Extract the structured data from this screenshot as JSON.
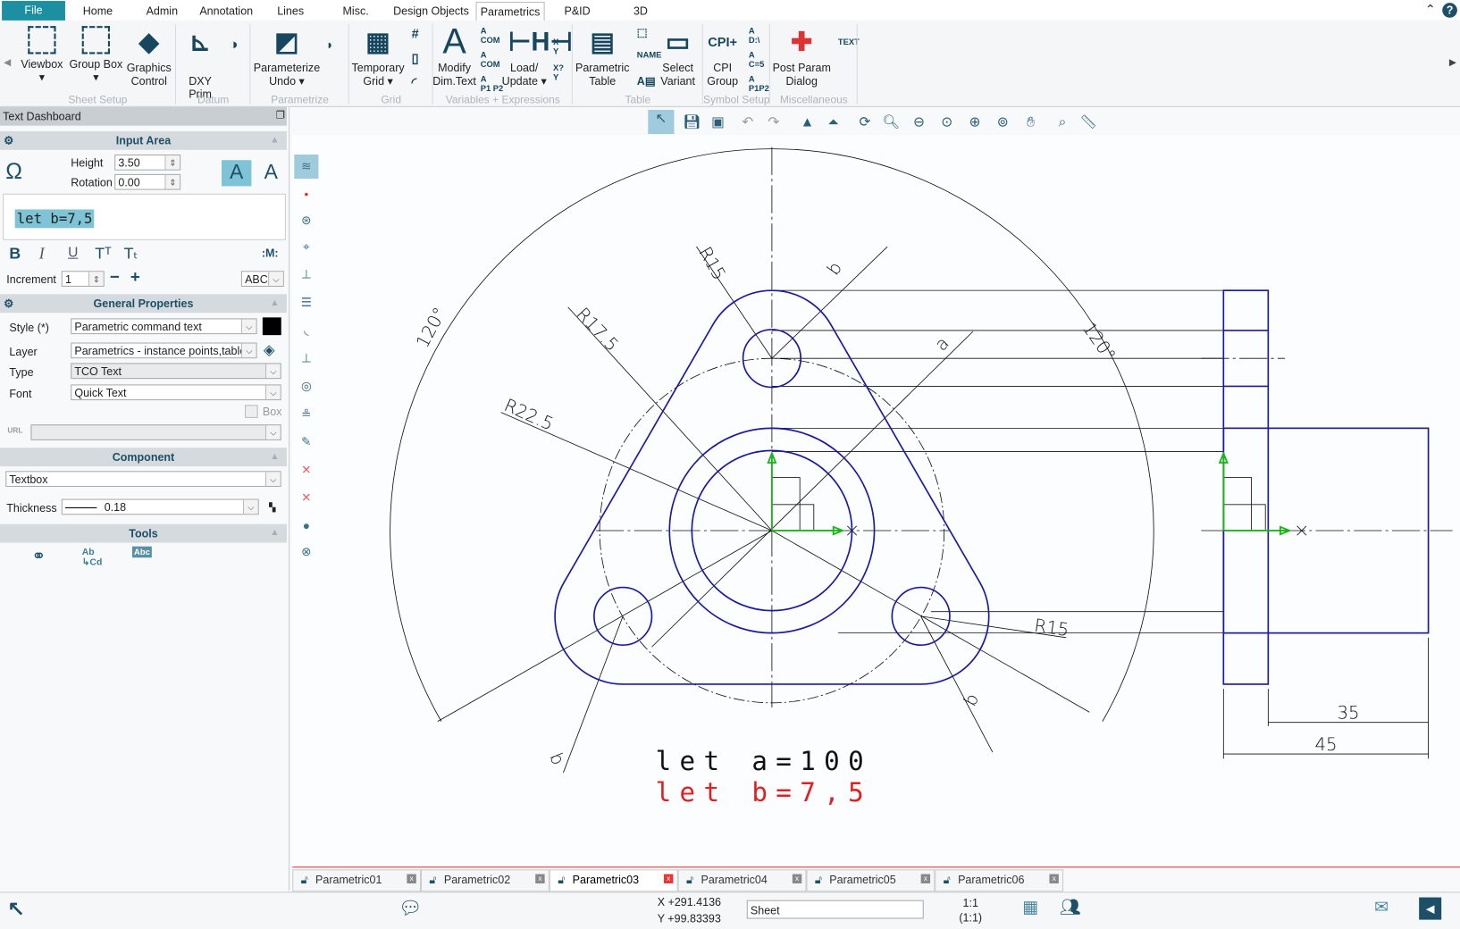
{
  "menu_tabs": [
    "File",
    "Home",
    "Admin",
    "Annotation",
    "Lines",
    "Misc.",
    "Design Objects",
    "Parametrics",
    "P&ID",
    "3D"
  ],
  "active_tab": "Parametrics",
  "ribbon": {
    "buttons": [
      {
        "label": "Viewbox",
        "icon": "viewbox-icon"
      },
      {
        "label": "Group Box",
        "icon": "group-box-icon"
      },
      {
        "label": "Graphics Control",
        "icon": "graphics-control-icon"
      },
      {
        "label": "DXY Prim",
        "icon": "dxy-prim-icon"
      },
      {
        "label": "Parameterize Undo",
        "icon": "parameterize-undo-icon"
      },
      {
        "label": "Temporary Grid",
        "icon": "temporary-grid-icon"
      },
      {
        "label": "Modify Dim.Text",
        "icon": "modify-dim-text-icon"
      },
      {
        "label": "Load/ Update",
        "icon": "load-update-icon"
      },
      {
        "label": "Parametric Table",
        "icon": "parametric-table-icon"
      },
      {
        "label": "Select Variant",
        "icon": "select-variant-icon"
      },
      {
        "label": "CPI Group",
        "icon": "cpi-group-icon"
      },
      {
        "label": "Post Param Dialog",
        "icon": "post-param-dialog-icon"
      }
    ],
    "groups": [
      "Sheet Setup",
      "Datum",
      "Parametrize",
      "Grid",
      "Variables + Expressions",
      "Table",
      "Symbol Setup",
      "Miscellaneous"
    ]
  },
  "panel": {
    "title": "Text Dashboard",
    "input_area": {
      "header": "Input Area",
      "height_label": "Height",
      "height": "3.50",
      "rotation_label": "Rotation",
      "rotation": "0.00",
      "text": "let b=7,5",
      "increment_label": "Increment",
      "increment": "1",
      "case": "ABC"
    },
    "general": {
      "header": "General Properties",
      "style_label": "Style (*)",
      "style": "Parametric command text",
      "layer_label": "Layer",
      "layer": "Parametrics - instance points,tables",
      "type_label": "Type",
      "type": "TCO Text",
      "font_label": "Font",
      "font": "Quick Text",
      "box_label": "Box",
      "style_color": "#000000"
    },
    "component": {
      "header": "Component",
      "value": "Textbox",
      "thickness_label": "Thickness",
      "thickness": "0.18"
    },
    "tools": {
      "header": "Tools"
    }
  },
  "drawing": {
    "dims": [
      "R15",
      "R17.5",
      "R22.5",
      "120°",
      "120°",
      "b",
      "b",
      "b",
      "a",
      "R15",
      "35",
      "45"
    ],
    "texts": [
      "let a=100",
      "let b=7,5"
    ],
    "colors": {
      "geometry": "#1a1aa0",
      "axes": "#1db31d",
      "highlight_text": "#e02020"
    }
  },
  "doc_tabs": [
    "Parametric01",
    "Parametric02",
    "Parametric03",
    "Parametric04",
    "Parametric05",
    "Parametric06"
  ],
  "active_doc": "Parametric03",
  "status": {
    "x": "X +291.4136",
    "y": "Y +99.83393",
    "mode": "Sheet",
    "scale": "1:1",
    "scale2": "(1:1)"
  }
}
